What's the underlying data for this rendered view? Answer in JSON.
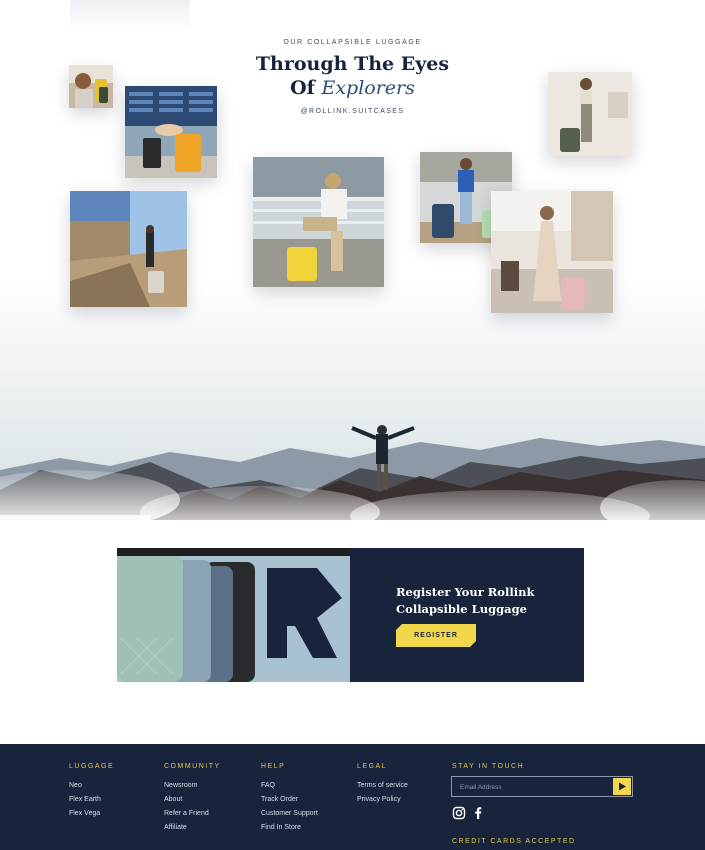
{
  "hero": {
    "eyebrow": "OUR COLLAPSIBLE LUGGAGE",
    "title_line1": "Through The Eyes",
    "title_line2_plain": "Of ",
    "title_line2_accent": "Explorers",
    "handle": "@ROLLINK.SUITCASES"
  },
  "register": {
    "title_line1": "Register Your Rollink",
    "title_line2": "Collapsible Luggage",
    "button_label": "REGISTER",
    "luggage_brand": "Rollink"
  },
  "footer": {
    "columns": [
      {
        "heading": "LUGGAGE",
        "links": [
          "Neo",
          "Flex Earth",
          "Flex Vega"
        ]
      },
      {
        "heading": "COMMUNITY",
        "links": [
          "Newsroom",
          "About",
          "Refer a Friend",
          "Affiliate"
        ]
      },
      {
        "heading": "HELP",
        "links": [
          "FAQ",
          "Track Order",
          "Customer Support",
          "Find In Store"
        ]
      },
      {
        "heading": "LEGAL",
        "links": [
          "Terms of service",
          "Privacy Policy"
        ]
      }
    ],
    "stay_in_touch": "STAY IN TOUCH",
    "email_placeholder": "Email Address",
    "social_icons": [
      "instagram-icon",
      "facebook-icon"
    ],
    "credit_cards_heading": "CREDIT CARDS ACCEPTED"
  },
  "colors": {
    "navy": "#17243c",
    "accent_yellow": "#f2d64b",
    "footer_heading": "#e3c94a",
    "title_accent": "#2c4d78"
  }
}
